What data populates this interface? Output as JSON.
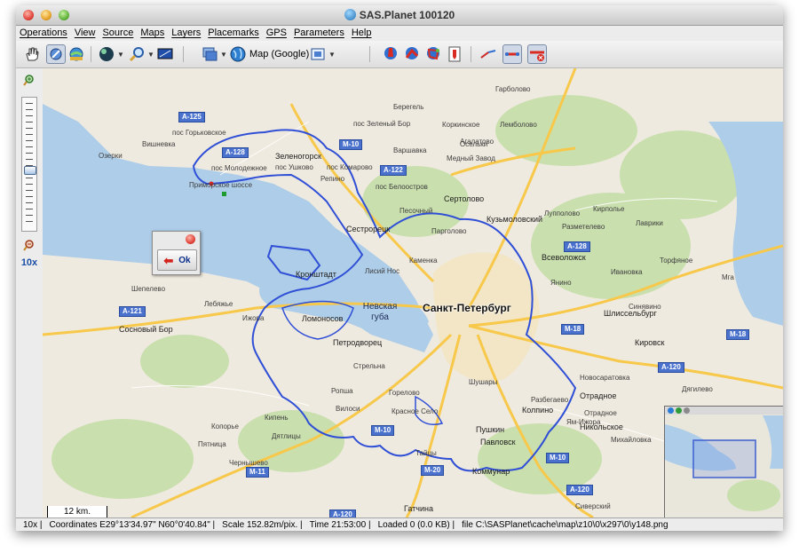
{
  "window": {
    "title": "SAS.Planet 100120"
  },
  "menu": [
    "Operations",
    "View",
    "Source",
    "Maps",
    "Layers",
    "Placemarks",
    "GPS",
    "Parameters",
    "Help"
  ],
  "toolbar": {
    "icons": [
      "hand-tool-icon",
      "select-area-icon",
      "globe-search-icon",
      "sphere-layer-icon",
      "magnifier-icon",
      "gps-display-icon",
      "layers-stack-icon",
      "map-globe-icon",
      "satellite-icon",
      "placemark-add-icon",
      "path-add-icon",
      "polygon-add-icon",
      "save-placemark-icon",
      "ruler-icon",
      "line-tool-icon",
      "line-delete-icon"
    ],
    "map_source": "Map (Google)"
  },
  "zoom": {
    "level": "10x",
    "level_fraction": 0.55
  },
  "popup": {
    "ok_label": "Ok"
  },
  "map": {
    "cities": [
      "Санкт-Петербург"
    ],
    "water": [
      "Невская губа"
    ],
    "towns": [
      "Зеленогорск",
      "Сестрорецк",
      "Кронштадт",
      "Ломоносов",
      "Петродворец",
      "Колпино",
      "Пушкин",
      "Павловск",
      "Коммунар",
      "Сосновый Бор",
      "Кировск",
      "Шлиссельбург",
      "Всеволожск",
      "Кузьмоловский",
      "Сертолово",
      "Гатчина",
      "Никольское",
      "Отрадное"
    ],
    "villages": [
      "пос Горьковское",
      "Вишневка",
      "Озерки",
      "пос Молодежное",
      "Приморское шоссе",
      "пос Ушково",
      "пос Комарово",
      "Репино",
      "пос Белоостров",
      "Песочный",
      "Парголово",
      "Лисий Нос",
      "Каменка",
      "Варшавка",
      "пос Зеленый Бор",
      "Берегель",
      "Медный Завод",
      "Агалатово",
      "Лемболово",
      "Гарболово",
      "Коркинское",
      "Осельки",
      "Лупполово",
      "Кирполье",
      "Разметелево",
      "Лаврики",
      "Янино",
      "Новосаратовка",
      "Ивановка",
      "Мга",
      "Разбегаево",
      "Дягилево",
      "Михайловка",
      "Горелово",
      "Ропша",
      "Стрельна",
      "Вилоси",
      "Дятлицы",
      "Ижора",
      "Лебяжье",
      "Шепелево",
      "Кипень",
      "Копорье",
      "Шушары",
      "Тайцы",
      "Сиверский",
      "Красное Село",
      "Синявино",
      "Отрадное",
      "Ям-Ижора",
      "Чернышево",
      "Пятница",
      "Торфяное"
    ],
    "highways": [
      "A-125",
      "A-128",
      "M-10",
      "A-122",
      "A-128",
      "A-121",
      "M-18",
      "M-18",
      "A-120",
      "M-11",
      "M-10",
      "M-20",
      "A-120",
      "A-120",
      "M-10"
    ],
    "scale_label": "12 km."
  },
  "status": {
    "zoom": "10x",
    "coordinates": "Coordinates E29°13'34.97\" N60°0'40.84\"",
    "scale": "Scale 152.82m/pix.",
    "time": "Time 21:53:00",
    "loaded": "Loaded 0 (0.0 KB)",
    "file": "file C:\\SASPlanet\\cache\\map\\z10\\0\\x297\\0\\y148.png"
  },
  "colors": {
    "boundary": "#2f4fd6",
    "water": "#aecde8",
    "road_main": "#f7c84a",
    "park": "#c9dfae"
  }
}
